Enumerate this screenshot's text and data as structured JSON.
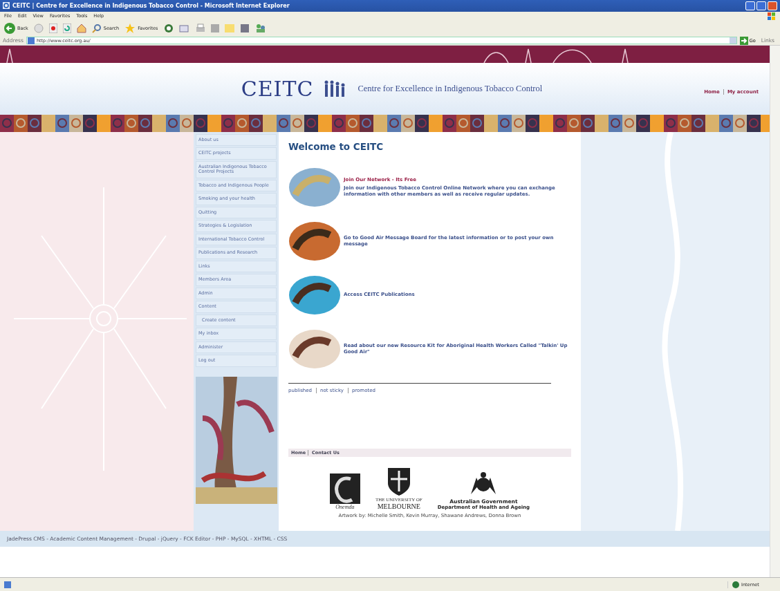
{
  "window": {
    "title": "CEITC | Centre for Excellence in Indigenous Tobacco Control - Microsoft Internet Explorer"
  },
  "menu": [
    "File",
    "Edit",
    "View",
    "Favorites",
    "Tools",
    "Help"
  ],
  "toolbar": {
    "back": "Back",
    "search": "Search",
    "favorites": "Favorites"
  },
  "address_bar": {
    "label": "Address",
    "url": "http://www.ceitc.org.au/",
    "go": "Go",
    "links": "Links"
  },
  "header": {
    "logo": "CEITC",
    "tagline": "Centre for Excellence in Indigenous Tobacco Control",
    "links": [
      "Home",
      "My account"
    ]
  },
  "nav": [
    {
      "label": "About us"
    },
    {
      "label": "CEITC projects"
    },
    {
      "label": "Australian Indigenous Tobacco Control Projects"
    },
    {
      "label": "Tobacco and Indigenous People"
    },
    {
      "label": "Smoking and your health"
    },
    {
      "label": "Quitting"
    },
    {
      "label": "Strategies & Legislation"
    },
    {
      "label": "International Tobacco Control"
    },
    {
      "label": "Publications and Research"
    },
    {
      "label": "Links"
    },
    {
      "label": "Members Area"
    },
    {
      "label": "Admin"
    },
    {
      "label": "Content",
      "children": [
        {
          "label": "Create content"
        }
      ]
    },
    {
      "label": "My inbox"
    },
    {
      "label": "Administer"
    },
    {
      "label": "Log out"
    }
  ],
  "content": {
    "heading": "Welcome to CEITC",
    "items": [
      {
        "title": "Join Our Network - Its Free",
        "text": "Join our Indigenous Tobacco Control Online Network where you can exchange information with other members as well as receive regular updates."
      },
      {
        "text": "Go to Good Air Message Board for the latest information or to post your own message"
      },
      {
        "text": "Access CEITC Publications"
      },
      {
        "text": "Read about our new Resource Kit for Aboriginal Health Workers Called \"Talkin' Up Good Air\""
      }
    ],
    "meta_links": [
      "published",
      "not sticky",
      "promoted"
    ]
  },
  "footer": {
    "links": [
      "Home",
      "Contact Us"
    ],
    "logos": [
      {
        "kind": "onemda",
        "text": "Onemda"
      },
      {
        "kind": "university",
        "line1": "THE UNIVERSITY OF",
        "line2": "MELBOURNE"
      },
      {
        "kind": "government",
        "line1": "Australian Government",
        "line2": "Department of Health and Ageing"
      }
    ],
    "credit": "Artwork by: Michelle Smith, Kevin Murray, Shawane Andrews, Donna Brown"
  },
  "bottom_bar": "JadePress CMS - Academic Content Management - Drupal - jQuery - FCK Editor - PHP - MySQL - XHTML - CSS",
  "status_bar": {
    "zone": "Internet"
  }
}
